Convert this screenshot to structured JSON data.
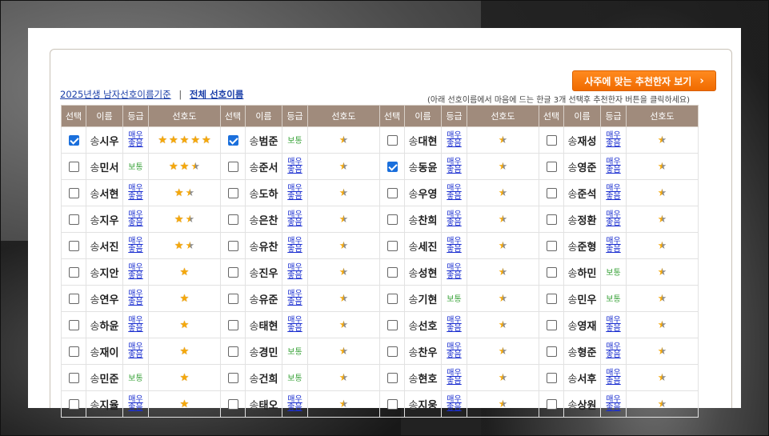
{
  "button": {
    "label": "사주에 맞는 추천한자 보기",
    "arrow": "›"
  },
  "links": {
    "birth_criteria": "2025년생 남자선호이름기준",
    "separator": "|",
    "all_names": "전체 선호이름"
  },
  "hint": "(아래 선호이름에서 마음에 드는 한글 3개 선택후 추천한자 버튼을 클릭하세요)",
  "headers": {
    "select": "선택",
    "name": "이름",
    "grade": "등급",
    "pref": "선호도"
  },
  "surname": "송",
  "grades": {
    "very_line1": "매우",
    "very_line2": "좋음",
    "normal": "보통"
  },
  "columns": [
    {
      "rows": [
        {
          "given": "시우",
          "checked": true,
          "grade": "very",
          "stars": 5
        },
        {
          "given": "민서",
          "checked": false,
          "grade": "normal",
          "stars": 2.5
        },
        {
          "given": "서현",
          "checked": false,
          "grade": "very",
          "stars": 1.5
        },
        {
          "given": "지우",
          "checked": false,
          "grade": "very",
          "stars": 1.5
        },
        {
          "given": "서진",
          "checked": false,
          "grade": "very",
          "stars": 1.5
        },
        {
          "given": "지안",
          "checked": false,
          "grade": "very",
          "stars": 1
        },
        {
          "given": "연우",
          "checked": false,
          "grade": "very",
          "stars": 1
        },
        {
          "given": "하윤",
          "checked": false,
          "grade": "very",
          "stars": 1
        },
        {
          "given": "재이",
          "checked": false,
          "grade": "very",
          "stars": 1
        },
        {
          "given": "민준",
          "checked": false,
          "grade": "normal",
          "stars": 1
        },
        {
          "given": "지율",
          "checked": false,
          "grade": "very",
          "stars": 1
        }
      ]
    },
    {
      "rows": [
        {
          "given": "범준",
          "checked": true,
          "grade": "normal",
          "stars": 0.5
        },
        {
          "given": "준서",
          "checked": false,
          "grade": "very",
          "stars": 0.5
        },
        {
          "given": "도하",
          "checked": false,
          "grade": "very",
          "stars": 0.5
        },
        {
          "given": "은찬",
          "checked": false,
          "grade": "very",
          "stars": 0.5
        },
        {
          "given": "유찬",
          "checked": false,
          "grade": "very",
          "stars": 0.5
        },
        {
          "given": "진우",
          "checked": false,
          "grade": "very",
          "stars": 0.5
        },
        {
          "given": "유준",
          "checked": false,
          "grade": "very",
          "stars": 0.5
        },
        {
          "given": "태현",
          "checked": false,
          "grade": "very",
          "stars": 0.5
        },
        {
          "given": "경민",
          "checked": false,
          "grade": "normal",
          "stars": 0.5
        },
        {
          "given": "건희",
          "checked": false,
          "grade": "normal",
          "stars": 0.5
        },
        {
          "given": "태오",
          "checked": false,
          "grade": "very",
          "stars": 0.5
        }
      ]
    },
    {
      "rows": [
        {
          "given": "대현",
          "checked": false,
          "grade": "very",
          "stars": 0.5
        },
        {
          "given": "동윤",
          "checked": true,
          "grade": "very",
          "stars": 0.5
        },
        {
          "given": "우영",
          "checked": false,
          "grade": "very",
          "stars": 0.5
        },
        {
          "given": "찬희",
          "checked": false,
          "grade": "very",
          "stars": 0.5
        },
        {
          "given": "세진",
          "checked": false,
          "grade": "very",
          "stars": 0.5
        },
        {
          "given": "성현",
          "checked": false,
          "grade": "very",
          "stars": 0.5
        },
        {
          "given": "기현",
          "checked": false,
          "grade": "normal",
          "stars": 0.5
        },
        {
          "given": "선호",
          "checked": false,
          "grade": "very",
          "stars": 0.5
        },
        {
          "given": "찬우",
          "checked": false,
          "grade": "very",
          "stars": 0.5
        },
        {
          "given": "현호",
          "checked": false,
          "grade": "very",
          "stars": 0.5
        },
        {
          "given": "지웅",
          "checked": false,
          "grade": "very",
          "stars": 0.5
        }
      ]
    },
    {
      "rows": [
        {
          "given": "재성",
          "checked": false,
          "grade": "very",
          "stars": 0.5
        },
        {
          "given": "영준",
          "checked": false,
          "grade": "very",
          "stars": 0.5
        },
        {
          "given": "준석",
          "checked": false,
          "grade": "very",
          "stars": 0.5
        },
        {
          "given": "정환",
          "checked": false,
          "grade": "very",
          "stars": 0.5
        },
        {
          "given": "준형",
          "checked": false,
          "grade": "very",
          "stars": 0.5
        },
        {
          "given": "하민",
          "checked": false,
          "grade": "normal",
          "stars": 0.5
        },
        {
          "given": "민우",
          "checked": false,
          "grade": "normal",
          "stars": 0.5
        },
        {
          "given": "영재",
          "checked": false,
          "grade": "very",
          "stars": 0.5
        },
        {
          "given": "형준",
          "checked": false,
          "grade": "very",
          "stars": 0.5
        },
        {
          "given": "서후",
          "checked": false,
          "grade": "very",
          "stars": 0.5
        },
        {
          "given": "상원",
          "checked": false,
          "grade": "very",
          "stars": 0.5
        }
      ]
    }
  ]
}
